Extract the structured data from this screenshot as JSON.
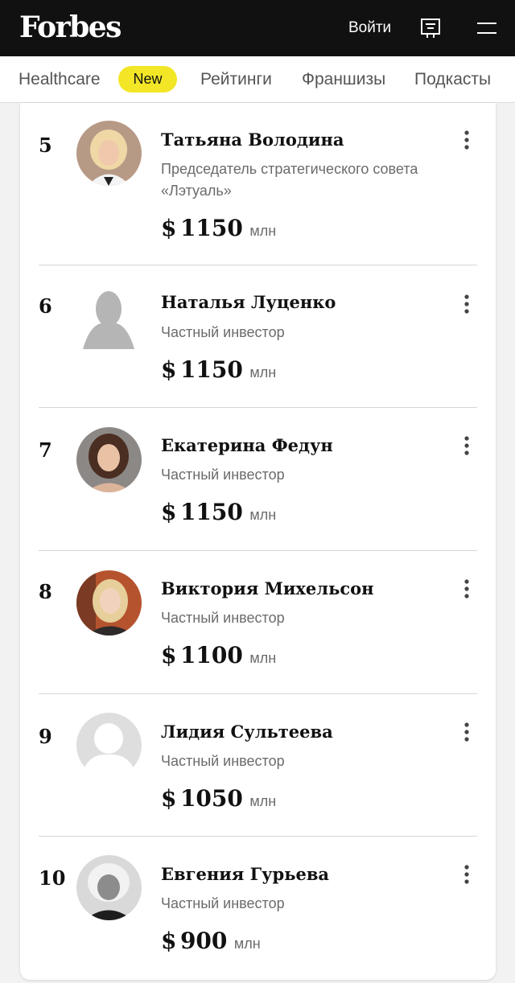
{
  "header": {
    "logo": "Forbes",
    "login_label": "Войти",
    "news_icon": "news-feed-icon",
    "menu_icon": "hamburger-menu-icon"
  },
  "nav": {
    "items": [
      "Healthcare",
      "New",
      "Рейтинги",
      "Франшизы",
      "Подкасты"
    ],
    "badge_color": "#f2e627"
  },
  "list": {
    "unit_currency": "$",
    "unit_label": "млн",
    "entries": [
      {
        "rank": "5",
        "name": "Татьяна Володина",
        "role": "Председатель стратегического совета «Лэтуаль»",
        "worth": "1150",
        "photo": "portrait-photo"
      },
      {
        "rank": "6",
        "name": "Наталья Луценко",
        "role": "Частный инвестор",
        "worth": "1150",
        "photo": "silhouette-placeholder"
      },
      {
        "rank": "7",
        "name": "Екатерина Федун",
        "role": "Частный инвестор",
        "worth": "1150",
        "photo": "portrait-photo"
      },
      {
        "rank": "8",
        "name": "Виктория Михельсон",
        "role": "Частный инвестор",
        "worth": "1100",
        "photo": "portrait-photo"
      },
      {
        "rank": "9",
        "name": "Лидия Сультеева",
        "role": "Частный инвестор",
        "worth": "1050",
        "photo": "silhouette-placeholder"
      },
      {
        "rank": "10",
        "name": "Евгения Гурьева",
        "role": "Частный инвестор",
        "worth": "900",
        "photo": "portrait-photo"
      }
    ]
  },
  "colors": {
    "header_bg": "#111111",
    "text_primary": "#111111",
    "text_secondary": "#6b6b6b"
  }
}
